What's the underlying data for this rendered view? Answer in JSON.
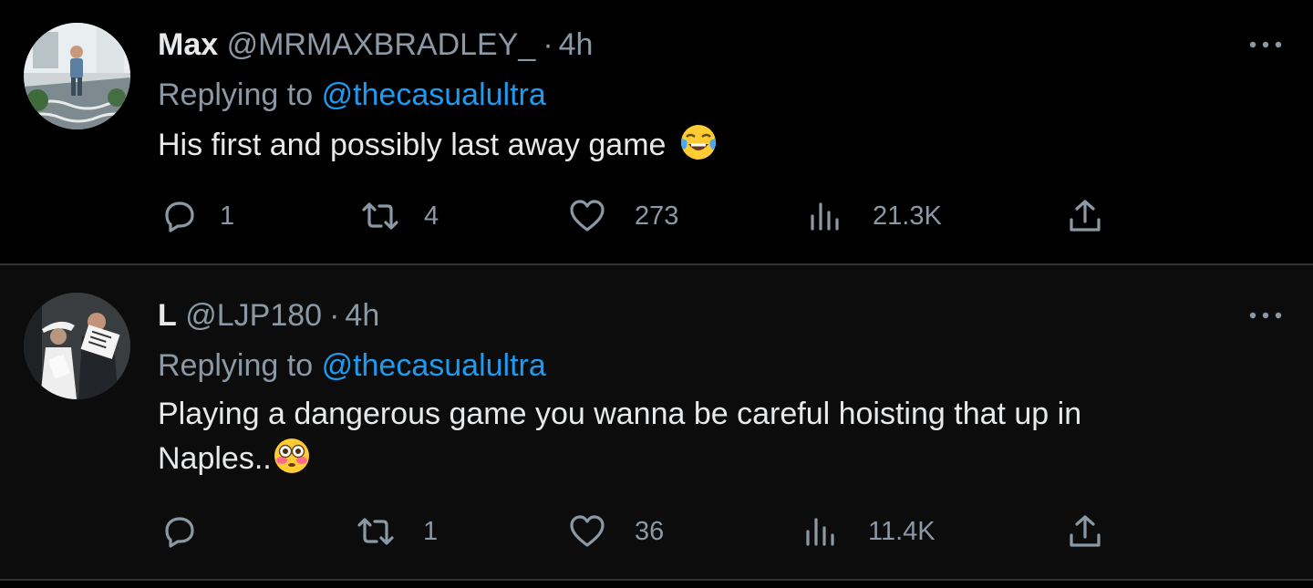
{
  "tweets": [
    {
      "display_name": "Max",
      "handle": "@MRMAXBRADLEY_",
      "separator": "·",
      "time": "4h",
      "replying_prefix": "Replying to",
      "replying_handle": "@thecasualultra",
      "text": "His first and possibly last away game",
      "emoji": "face-with-tears-of-joy",
      "replies": "1",
      "retweets": "4",
      "likes": "273",
      "views": "21.3K"
    },
    {
      "display_name": "L",
      "handle": "@LJP180",
      "separator": "·",
      "time": "4h",
      "replying_prefix": "Replying to",
      "replying_handle": "@thecasualultra",
      "text_line1": "Playing a dangerous game you wanna be careful hoisting that up in",
      "text_line2": "Naples..",
      "emoji": "flushed-face",
      "replies": "",
      "retweets": "1",
      "likes": "36",
      "views": "11.4K"
    }
  ],
  "colors": {
    "background": "#000000",
    "text_primary": "#e7e9ea",
    "text_secondary": "#8b98a5",
    "link": "#1d9bf0",
    "divider": "#2f3336"
  }
}
